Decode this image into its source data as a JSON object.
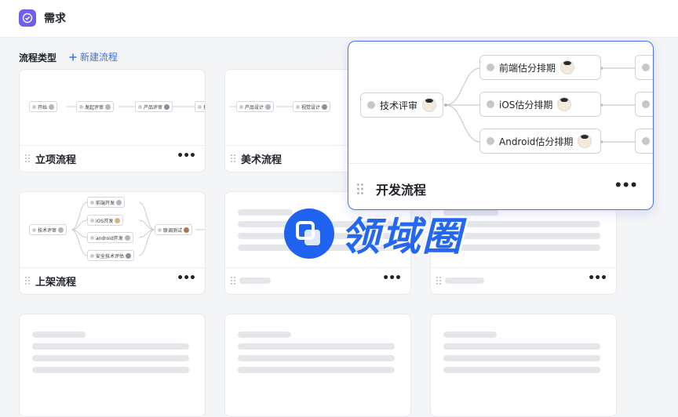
{
  "header": {
    "title": "需求"
  },
  "section": {
    "title": "流程类型",
    "new_label": "新建流程"
  },
  "cards": [
    {
      "name": "立项流程",
      "more": "•••",
      "nodes": [
        "开始",
        "发起评审",
        "产品评审",
        "技"
      ]
    },
    {
      "name": "美术流程",
      "more": "•••",
      "nodes": [
        "产品设计",
        "视觉设计"
      ]
    },
    {
      "name": "上架流程",
      "more": "•••",
      "nodes": [
        "技术评审",
        "前端开发",
        "iOS开发",
        "android开发",
        "安全技术评估",
        "联调测试"
      ]
    }
  ],
  "featured": {
    "name": "开发流程",
    "more": "•••",
    "nodes": [
      "技术评审",
      "前端估分排期",
      "iOS估分排期",
      "Android估分排期"
    ]
  },
  "watermark": {
    "text": "领域圈"
  },
  "colors": {
    "accent": "#3370ff",
    "brand": "#6f5ef0",
    "highlight_border": "#4e6ef2"
  }
}
